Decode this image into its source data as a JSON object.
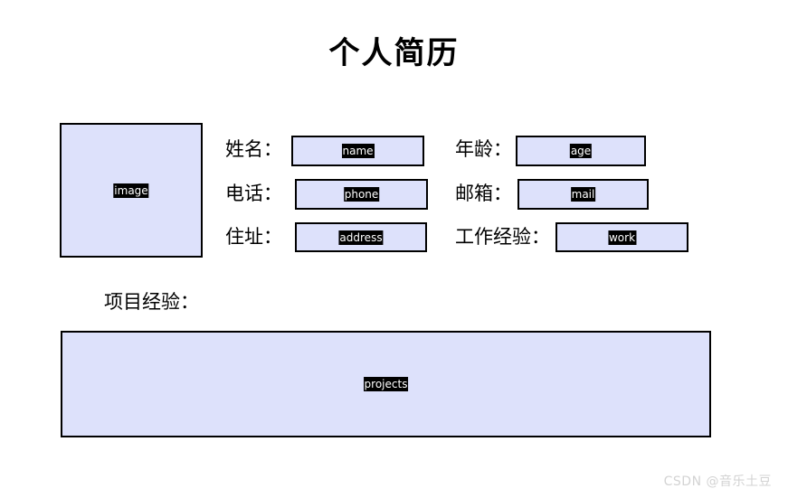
{
  "page": {
    "title": "个人简历",
    "background_color": "#ffffff",
    "field_fill_color": "#dde1fb",
    "field_border_color": "#000000",
    "chip_bg_color": "#000000",
    "chip_text_color": "#ffffff"
  },
  "photo": {
    "placeholder": "image"
  },
  "fields": [
    {
      "label": "姓名：",
      "placeholder": "name"
    },
    {
      "label": "年龄：",
      "placeholder": "age"
    },
    {
      "label": "电话：",
      "placeholder": "phone"
    },
    {
      "label": "邮箱：",
      "placeholder": "mail"
    },
    {
      "label": "住址：",
      "placeholder": "address"
    },
    {
      "label": "工作经验：",
      "placeholder": "work"
    }
  ],
  "projects": {
    "label": "项目经验：",
    "placeholder": "projects"
  },
  "watermark": {
    "text": "CSDN @音乐土豆"
  }
}
